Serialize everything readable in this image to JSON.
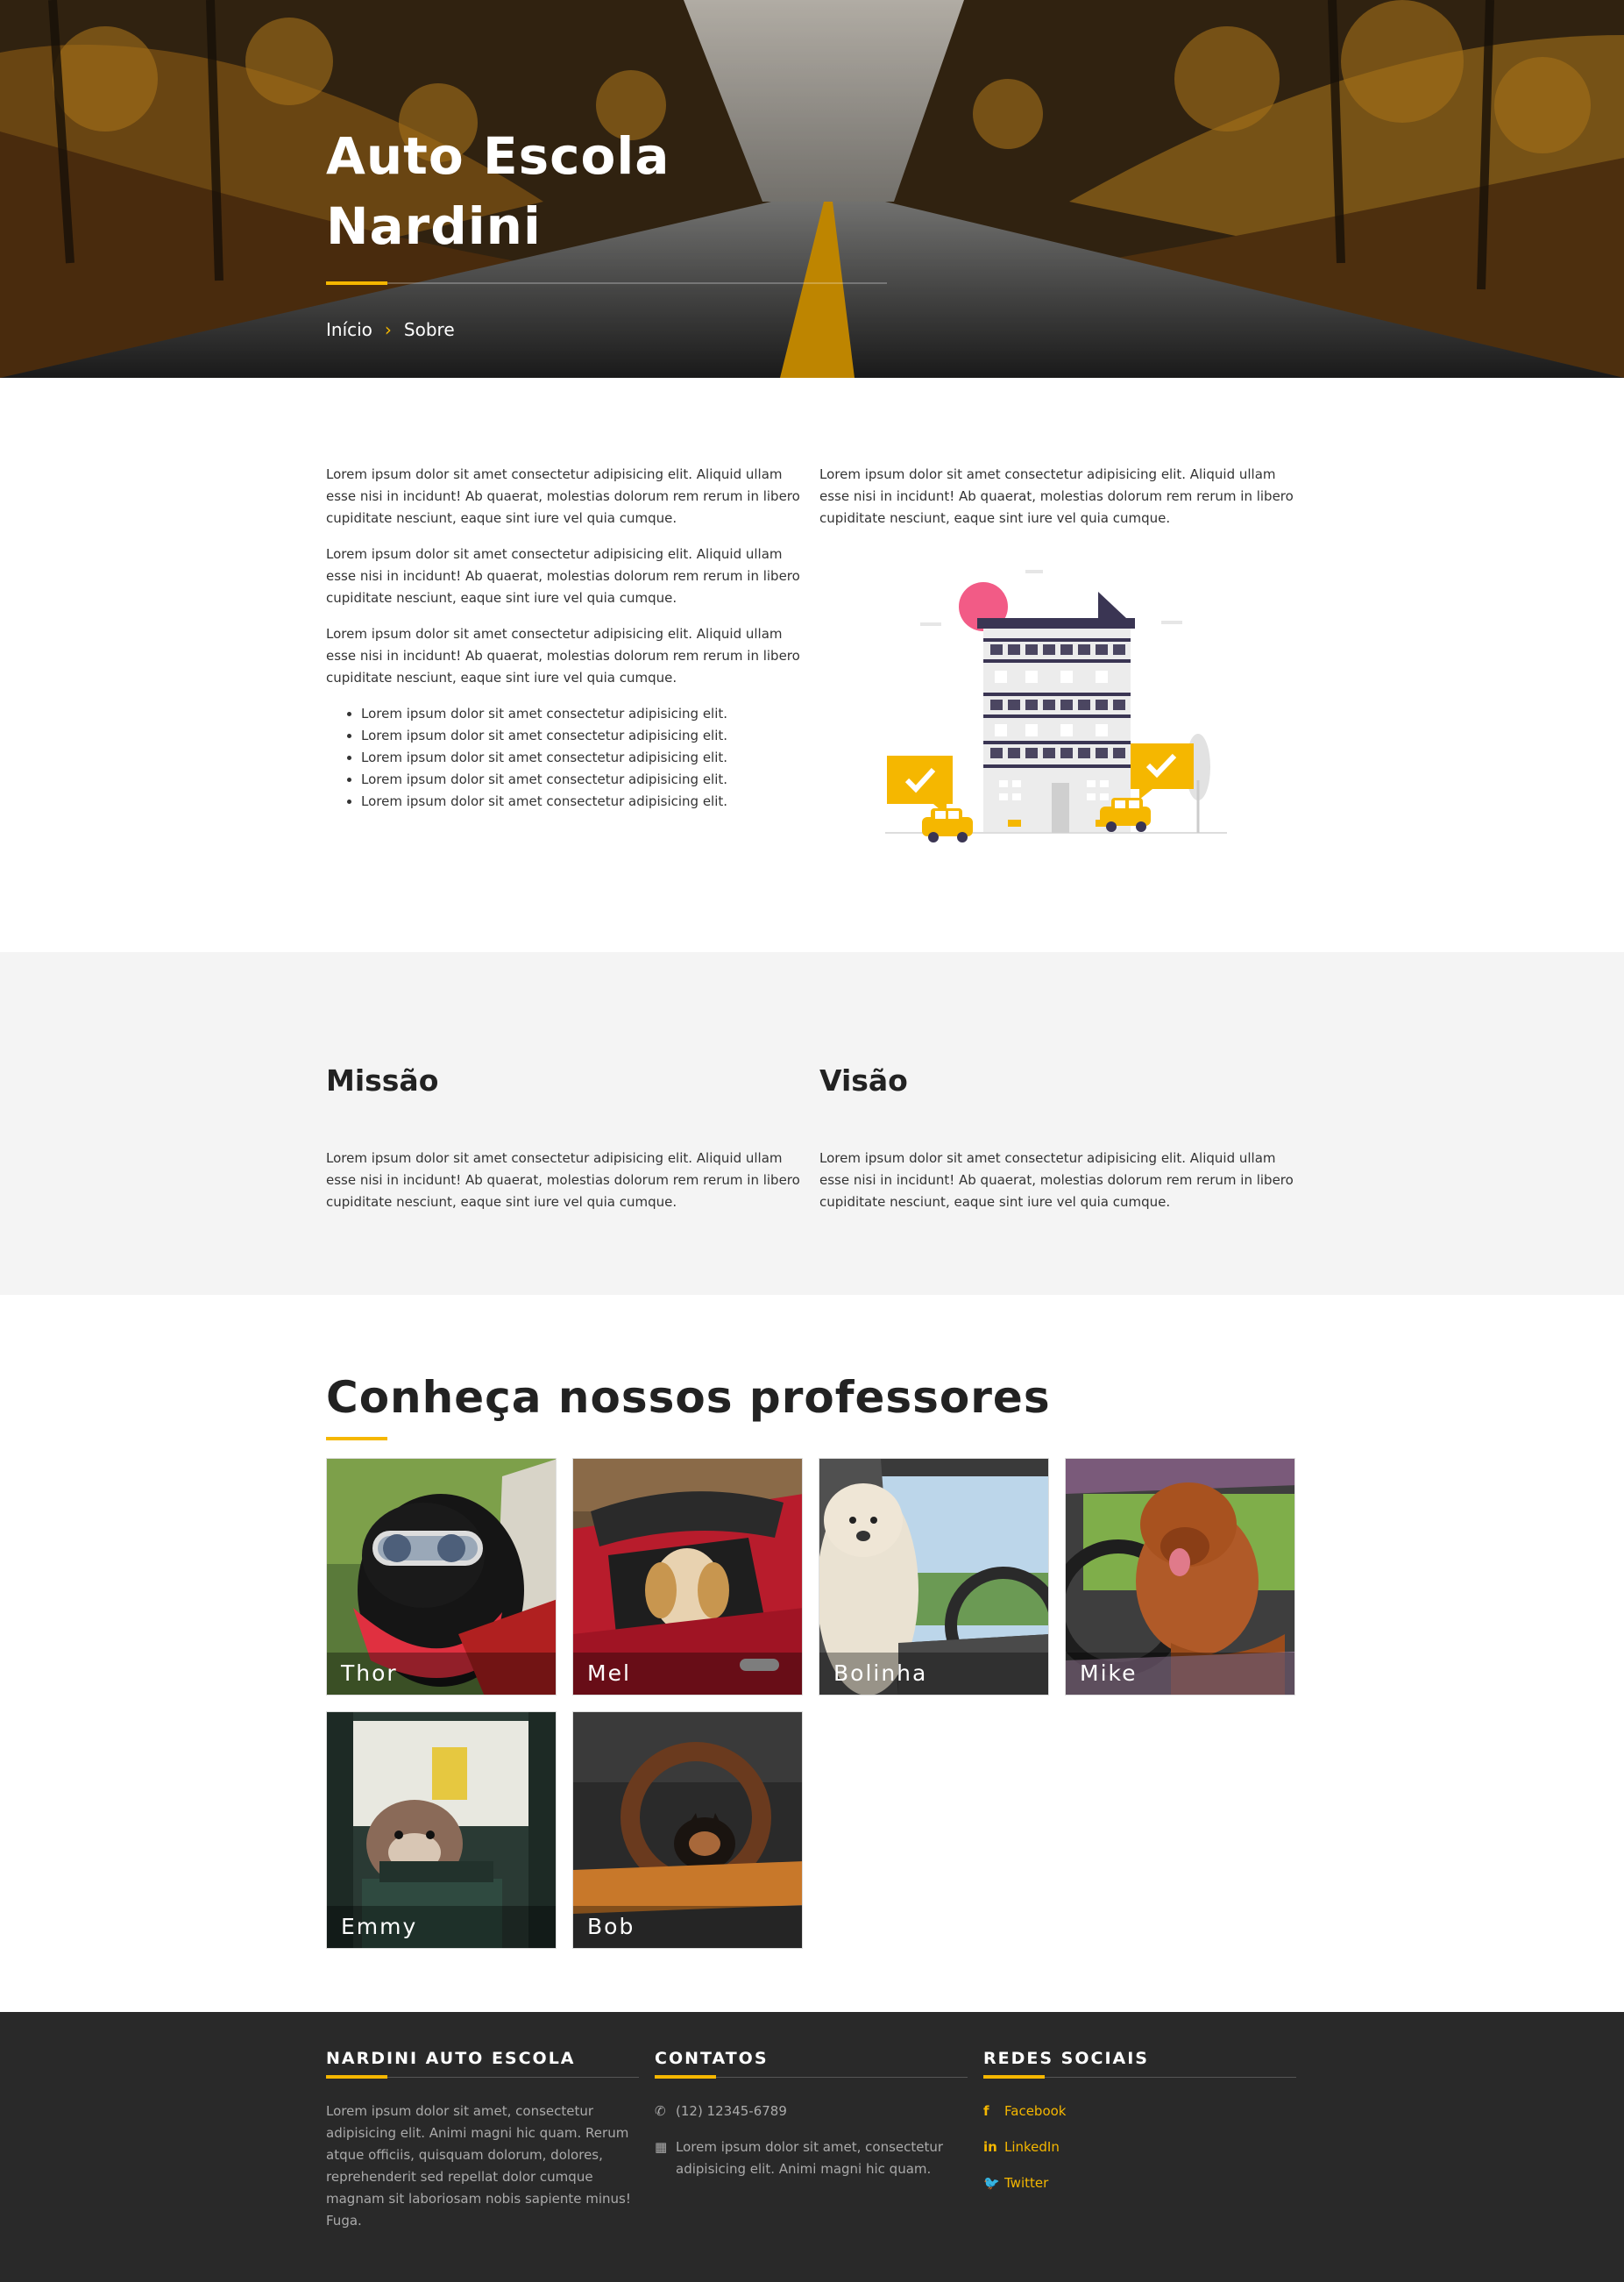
{
  "hero": {
    "title": "Auto Escola Nardini",
    "breadcrumb": {
      "home": "Início",
      "separator": "›",
      "current": "Sobre"
    }
  },
  "about": {
    "left_paragraphs": [
      "Lorem ipsum dolor sit amet consectetur adipisicing elit. Aliquid ullam esse nisi in incidunt! Ab quaerat, molestias dolorum rem rerum in libero cupiditate nesciunt, eaque sint iure vel quia cumque.",
      "Lorem ipsum dolor sit amet consectetur adipisicing elit. Aliquid ullam esse nisi in incidunt! Ab quaerat, molestias dolorum rem rerum in libero cupiditate nesciunt, eaque sint iure vel quia cumque.",
      "Lorem ipsum dolor sit amet consectetur adipisicing elit. Aliquid ullam esse nisi in incidunt! Ab quaerat, molestias dolorum rem rerum in libero cupiditate nesciunt, eaque sint iure vel quia cumque."
    ],
    "list": [
      "Lorem ipsum dolor sit amet consectetur adipisicing elit.",
      "Lorem ipsum dolor sit amet consectetur adipisicing elit.",
      "Lorem ipsum dolor sit amet consectetur adipisicing elit.",
      "Lorem ipsum dolor sit amet consectetur adipisicing elit.",
      "Lorem ipsum dolor sit amet consectetur adipisicing elit."
    ],
    "right_paragraph": "Lorem ipsum dolor sit amet consectetur adipisicing elit. Aliquid ullam esse nisi in incidunt! Ab quaerat, molestias dolorum rem rerum in libero cupiditate nesciunt, eaque sint iure vel quia cumque."
  },
  "mission": {
    "mission_title": "Missão",
    "mission_text": "Lorem ipsum dolor sit amet consectetur adipisicing elit. Aliquid ullam esse nisi in incidunt! Ab quaerat, molestias dolorum rem rerum in libero cupiditate nesciunt, eaque sint iure vel quia cumque.",
    "vision_title": "Visão",
    "vision_text": "Lorem ipsum dolor sit amet consectetur adipisicing elit. Aliquid ullam esse nisi in incidunt! Ab quaerat, molestias dolorum rem rerum in libero cupiditate nesciunt, eaque sint iure vel quia cumque."
  },
  "teachers": {
    "title": "Conheça nossos professores",
    "items": [
      {
        "name": "Thor"
      },
      {
        "name": "Mel"
      },
      {
        "name": "Bolinha"
      },
      {
        "name": "Mike"
      },
      {
        "name": "Emmy"
      },
      {
        "name": "Bob"
      }
    ]
  },
  "footer": {
    "about_title": "NARDINI AUTO ESCOLA",
    "about_text": "Lorem ipsum dolor sit amet, consectetur adipisicing elit. Animi magni hic quam. Rerum atque officiis, quisquam dolorum, dolores, reprehenderit sed repellat dolor cumque magnam sit laboriosam nobis sapiente minus! Fuga.",
    "contacts_title": "CONTATOS",
    "phone": "(12) 12345-6789",
    "address": "Lorem ipsum dolor sit amet, consectetur adipisicing elit. Animi magni hic quam.",
    "social_title": "REDES SOCIAIS",
    "social": {
      "facebook": "Facebook",
      "linkedin": "LinkedIn",
      "twitter": "Twitter"
    }
  },
  "colors": {
    "accent": "#f5b700",
    "footer_bg": "#292929",
    "section_bg": "#f4f4f4"
  },
  "icons": {
    "phone": "phone-icon",
    "address": "building-icon",
    "facebook": "facebook-icon",
    "linkedin": "linkedin-icon",
    "twitter": "twitter-icon"
  }
}
